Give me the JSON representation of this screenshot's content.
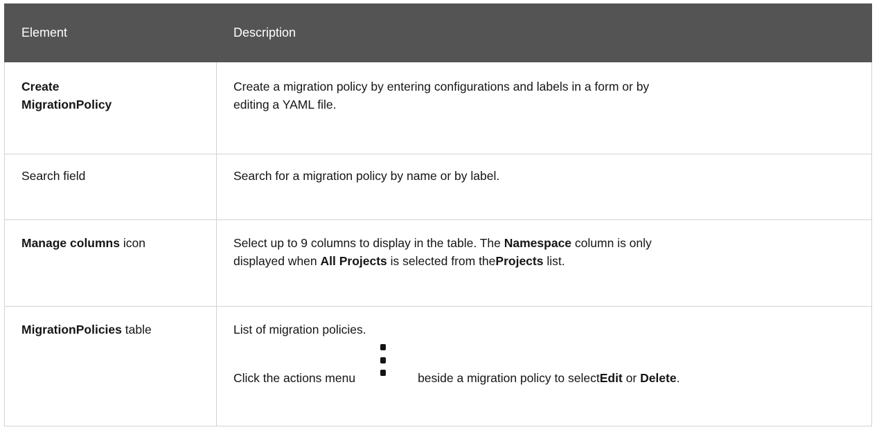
{
  "table": {
    "headers": [
      "Element",
      "Description"
    ],
    "rows": [
      {
        "element": "Create MigrationPolicy",
        "element_line1": "Create",
        "element_line2": "MigrationPolicy",
        "desc_line1": "Create a migration policy by entering configurations and labels in a form or by",
        "desc_line2": "editing a YAML file."
      },
      {
        "element": "Search field",
        "desc": "Search for a migration policy by name or by label."
      },
      {
        "element_strong": "Manage columns",
        "element_rest": " icon",
        "desc_a": "Select up to 9 columns to display in the table. The ",
        "desc_b": "Namespace",
        "desc_c": " column is only",
        "desc_d": "displayed when ",
        "desc_e": "All Projects",
        "desc_f": " is selected from the",
        "desc_g": "Projects",
        "desc_h": " list."
      },
      {
        "element_strong": "MigrationPolicies",
        "element_rest": " table",
        "desc_line1": "List of migration policies.",
        "desc_a": "Click the actions menu",
        "kebab_icon": "kebab-menu-icon",
        "desc_b": "beside a migration policy to select ",
        "desc_c": "Edit",
        "desc_d": " or ",
        "desc_e": "Delete",
        "desc_f": "."
      }
    ]
  }
}
